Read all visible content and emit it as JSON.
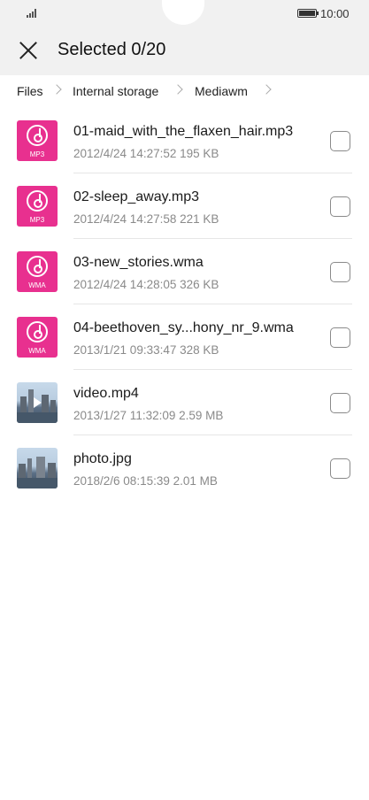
{
  "status_bar": {
    "time": "10:00"
  },
  "header": {
    "title": "Selected 0/20"
  },
  "breadcrumb": [
    "Files",
    "Internal storage",
    "Mediawm"
  ],
  "files": [
    {
      "name": "01-maid_with_the_flaxen_hair.mp3",
      "meta": "2012/4/24 14:27:52 195 KB",
      "kind": "audio",
      "ext": "MP3"
    },
    {
      "name": "02-sleep_away.mp3",
      "meta": "2012/4/24 14:27:58 221 KB",
      "kind": "audio",
      "ext": "MP3"
    },
    {
      "name": "03-new_stories.wma",
      "meta": "2012/4/24 14:28:05 326 KB",
      "kind": "audio",
      "ext": "WMA"
    },
    {
      "name": "04-beethoven_sy...hony_nr_9.wma",
      "meta": "2013/1/21 09:33:47 328 KB",
      "kind": "audio",
      "ext": "WMA"
    },
    {
      "name": "video.mp4",
      "meta": "2013/1/27 11:32:09 2.59 MB",
      "kind": "video"
    },
    {
      "name": "photo.jpg",
      "meta": "2018/2/6 08:15:39 2.01 MB",
      "kind": "image"
    }
  ],
  "colors": {
    "accent": "#e8308f",
    "header_bg": "#f1f1f1"
  }
}
